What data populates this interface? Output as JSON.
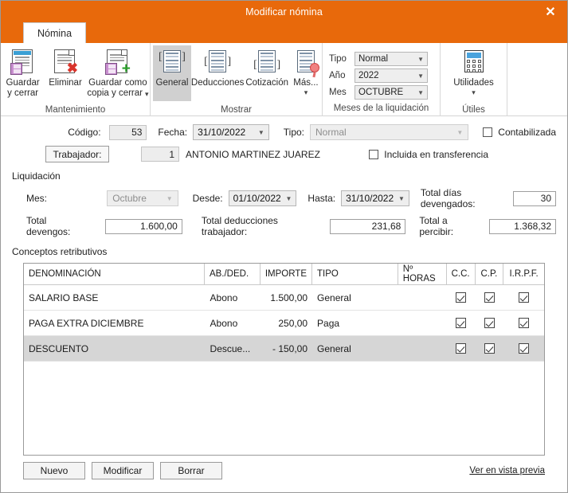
{
  "window": {
    "title": "Modificar nómina",
    "close_icon": "close-icon",
    "accent_color": "#e8690b"
  },
  "tabs": [
    {
      "label": "Nómina",
      "active": true
    }
  ],
  "ribbon": {
    "groups": [
      {
        "name": "mantenimiento",
        "label": "Mantenimiento",
        "buttons": [
          {
            "label": "Guardar\ny cerrar",
            "line1": "Guardar",
            "line2": "y cerrar",
            "icon": "save-close-icon"
          },
          {
            "label": "Eliminar",
            "line1": "Eliminar",
            "line2": "",
            "icon": "delete-icon"
          },
          {
            "label": "Guardar como copia y cerrar",
            "line1": "Guardar como",
            "line2": "copia y cerrar",
            "icon": "save-copy-icon"
          }
        ]
      },
      {
        "name": "mostrar",
        "label": "Mostrar",
        "buttons": [
          {
            "line1": "General",
            "icon": "report-general-icon",
            "selected": true
          },
          {
            "line1": "Deducciones",
            "icon": "report-deductions-icon",
            "selected": false
          },
          {
            "line1": "Cotización",
            "icon": "report-contributions-icon",
            "selected": false
          },
          {
            "line1": "Más...",
            "icon": "report-more-icon",
            "selected": false
          }
        ]
      },
      {
        "name": "meses-liquidacion",
        "label": "Meses de la liquidación",
        "fields": [
          {
            "label": "Tipo",
            "value": "Normal"
          },
          {
            "label": "Año",
            "value": "2022"
          },
          {
            "label": "Mes",
            "value": "OCTUBRE"
          }
        ]
      },
      {
        "name": "utiles",
        "label": "Útiles",
        "buttons": [
          {
            "line1": "Utilidades",
            "icon": "calculator-icon"
          }
        ]
      }
    ]
  },
  "form": {
    "codigo_label": "Código:",
    "codigo_value": "53",
    "fecha_label": "Fecha:",
    "fecha_value": "31/10/2022",
    "tipo_label": "Tipo:",
    "tipo_value": "Normal",
    "trabajador_label": "Trabajador:",
    "trabajador_code": "1",
    "trabajador_name": "ANTONIO MARTINEZ JUAREZ",
    "contabilizada_label": "Contabilizada",
    "contabilizada_checked": false,
    "incluida_label": "Incluida en transferencia",
    "incluida_checked": false
  },
  "liquidacion": {
    "section_label": "Liquidación",
    "mes_label": "Mes:",
    "mes_value": "Octubre",
    "desde_label": "Desde:",
    "desde_value": "01/10/2022",
    "hasta_label": "Hasta:",
    "hasta_value": "31/10/2022",
    "total_dias_label": "Total días devengados:",
    "total_dias_value": "30",
    "total_devengos_label": "Total devengos:",
    "total_devengos_value": "1.600,00",
    "total_deducciones_label": "Total deducciones trabajador:",
    "total_deducciones_value": "231,68",
    "total_percibir_label": "Total a percibir:",
    "total_percibir_value": "1.368,32"
  },
  "conceptos": {
    "section_label": "Conceptos retributivos",
    "columns": [
      "DENOMINACIÓN",
      "AB./DED.",
      "IMPORTE",
      "TIPO",
      "Nº HORAS",
      "C.C.",
      "C.P.",
      "I.R.P.F."
    ],
    "rows": [
      {
        "denominacion": "SALARIO BASE",
        "abded": "Abono",
        "importe": "1.500,00",
        "tipo": "General",
        "horas": "",
        "cc": true,
        "cp": true,
        "irpf": true,
        "selected": false
      },
      {
        "denominacion": "PAGA EXTRA DICIEMBRE",
        "abded": "Abono",
        "importe": "250,00",
        "tipo": "Paga",
        "horas": "",
        "cc": true,
        "cp": true,
        "irpf": true,
        "selected": false
      },
      {
        "denominacion": "DESCUENTO",
        "abded": "Descue...",
        "importe": "- 150,00",
        "tipo": "General",
        "horas": "",
        "cc": true,
        "cp": true,
        "irpf": true,
        "selected": true
      }
    ],
    "buttons": [
      {
        "label": "Nuevo"
      },
      {
        "label": "Modificar"
      },
      {
        "label": "Borrar"
      }
    ],
    "preview_link": "Ver en vista previa"
  }
}
